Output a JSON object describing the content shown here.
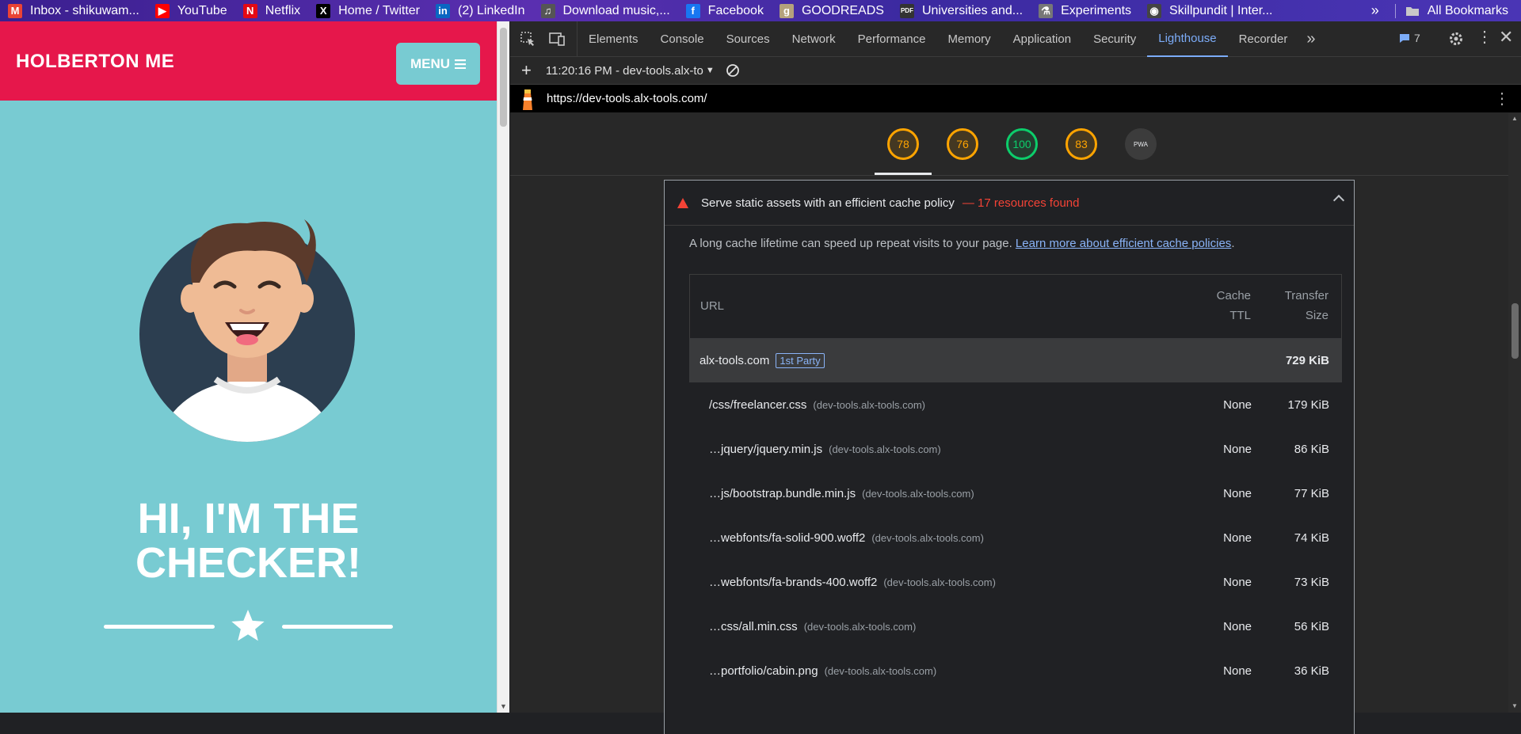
{
  "bookmarks": [
    {
      "label": "Inbox - shikuwam...",
      "icon": "gmail-icon",
      "glyph": "M",
      "color": "#ea4335"
    },
    {
      "label": "YouTube",
      "icon": "youtube-icon",
      "glyph": "▶",
      "color": "#ff0000"
    },
    {
      "label": "Netflix",
      "icon": "netflix-icon",
      "glyph": "N",
      "color": "#e50914"
    },
    {
      "label": "Home / Twitter",
      "icon": "x-twitter-icon",
      "glyph": "X",
      "color": "#000000"
    },
    {
      "label": "(2) LinkedIn",
      "icon": "linkedin-icon",
      "glyph": "in",
      "color": "#0a66c2"
    },
    {
      "label": "Download music,...",
      "icon": "music-site-icon",
      "glyph": "♫",
      "color": "#555555"
    },
    {
      "label": "Facebook",
      "icon": "facebook-icon",
      "glyph": "f",
      "color": "#1877f2"
    },
    {
      "label": "GOODREADS",
      "icon": "goodreads-icon",
      "glyph": "g",
      "color": "#b5a27c"
    },
    {
      "label": "Universities and...",
      "icon": "pdf-icon",
      "glyph": "PDF",
      "color": "#333333"
    },
    {
      "label": "Experiments",
      "icon": "flask-icon",
      "glyph": "⚗",
      "color": "#777777"
    },
    {
      "label": "Skillpundit | Inter...",
      "icon": "skillpundit-icon",
      "glyph": "◉",
      "color": "#444444"
    }
  ],
  "bookmarks_more": "»",
  "all_bookmarks": "All Bookmarks",
  "site": {
    "brand": "HOLBERTON ME",
    "menu_label": "MENU",
    "hero_line1": "HI, I'M THE",
    "hero_line2": "CHECKER!"
  },
  "devtools": {
    "tabs": [
      "Elements",
      "Console",
      "Sources",
      "Network",
      "Performance",
      "Memory",
      "Application",
      "Security",
      "Lighthouse",
      "Recorder"
    ],
    "active_tab": "Lighthouse",
    "issues_count": "7",
    "report_time": "11:20:16 PM - dev-tools.alx-to",
    "url": "https://dev-tools.alx-tools.com/"
  },
  "scores": [
    {
      "value": "78",
      "color": "#ffa400"
    },
    {
      "value": "76",
      "color": "#ffa400"
    },
    {
      "value": "100",
      "color": "#0cce6b"
    },
    {
      "value": "83",
      "color": "#ffa400"
    },
    {
      "value": "PWA",
      "color": "#9aa0a6"
    }
  ],
  "audit": {
    "title": "Serve static assets with an efficient cache policy",
    "found": "— 17 resources found",
    "description": "A long cache lifetime can speed up repeat visits to your page.",
    "link": "Learn more about efficient cache policies",
    "col_url": "URL",
    "col_ttl_1": "Cache",
    "col_ttl_2": "TTL",
    "col_size_1": "Transfer",
    "col_size_2": "Size",
    "group": {
      "host": "alx-tools.com",
      "badge": "1st Party",
      "size": "729 KiB"
    },
    "rows": [
      {
        "url": "/css/freelancer.css",
        "host": "(dev-tools.alx-tools.com)",
        "ttl": "None",
        "size": "179 KiB"
      },
      {
        "url": "…jquery/jquery.min.js",
        "host": "(dev-tools.alx-tools.com)",
        "ttl": "None",
        "size": "86 KiB"
      },
      {
        "url": "…js/bootstrap.bundle.min.js",
        "host": "(dev-tools.alx-tools.com)",
        "ttl": "None",
        "size": "77 KiB"
      },
      {
        "url": "…webfonts/fa-solid-900.woff2",
        "host": "(dev-tools.alx-tools.com)",
        "ttl": "None",
        "size": "74 KiB"
      },
      {
        "url": "…webfonts/fa-brands-400.woff2",
        "host": "(dev-tools.alx-tools.com)",
        "ttl": "None",
        "size": "73 KiB"
      },
      {
        "url": "…css/all.min.css",
        "host": "(dev-tools.alx-tools.com)",
        "ttl": "None",
        "size": "56 KiB"
      },
      {
        "url": "…portfolio/cabin.png",
        "host": "(dev-tools.alx-tools.com)",
        "ttl": "None",
        "size": "36 KiB"
      }
    ]
  }
}
